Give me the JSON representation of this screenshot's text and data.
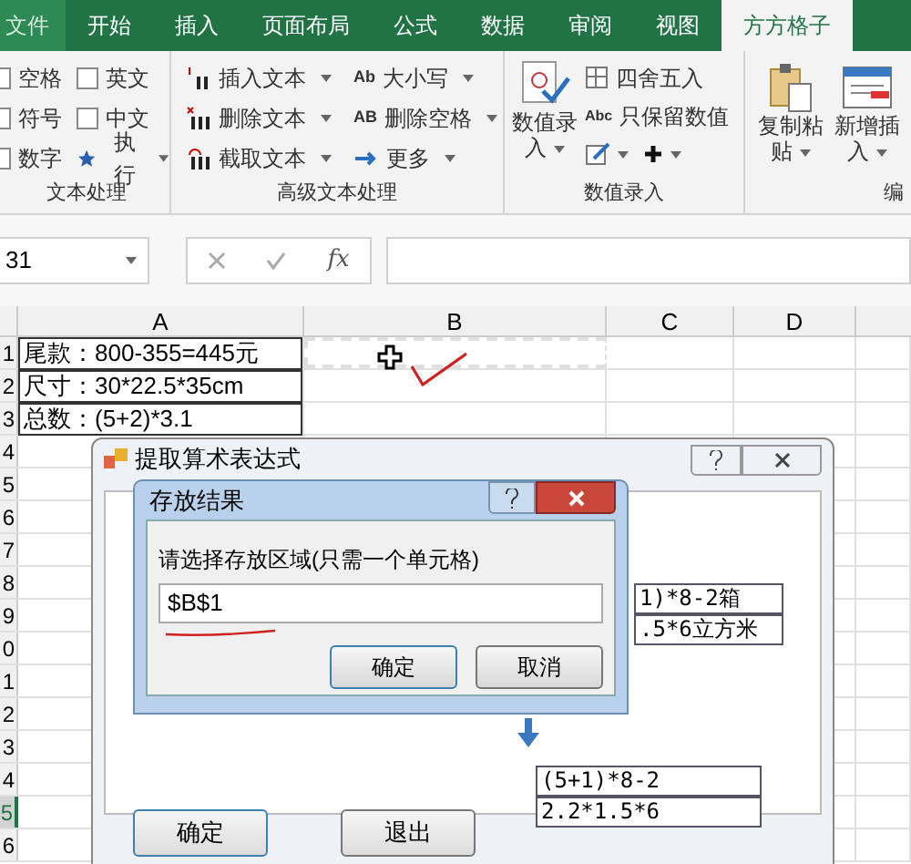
{
  "tabs": [
    {
      "label": "文件",
      "selected": false
    },
    {
      "label": "开始",
      "selected": false
    },
    {
      "label": "插入",
      "selected": false
    },
    {
      "label": "页面布局",
      "selected": false
    },
    {
      "label": "公式",
      "selected": false
    },
    {
      "label": "数据",
      "selected": false
    },
    {
      "label": "审阅",
      "selected": false
    },
    {
      "label": "视图",
      "selected": false
    },
    {
      "label": "方方格子",
      "selected": true
    }
  ],
  "ribbon": {
    "text_group": {
      "label": "文本处理",
      "checkboxes": [
        {
          "label": "空格",
          "checked": false
        },
        {
          "label": "符号",
          "checked": false
        },
        {
          "label": "数字",
          "checked": false
        },
        {
          "label": "英文",
          "checked": false
        },
        {
          "label": "中文",
          "checked": false
        }
      ],
      "run_button": "执行"
    },
    "advanced_group": {
      "label": "高级文本处理",
      "items": [
        {
          "label": "插入文本"
        },
        {
          "label": "删除文本"
        },
        {
          "label": "截取文本"
        },
        {
          "label": "大小写",
          "icon_text": "Ab"
        },
        {
          "label": "删除空格",
          "icon_text": "AB"
        },
        {
          "label": "更多"
        }
      ]
    },
    "number_group": {
      "label": "数值录入",
      "big_button": "数值录入",
      "items": [
        {
          "label": "四舍五入"
        },
        {
          "label": "只保留数值",
          "icon_text": "Abc"
        }
      ]
    },
    "edit_group": {
      "label": "编",
      "buttons": [
        "复制粘贴",
        "新增插入"
      ]
    }
  },
  "formula_bar": {
    "name_box": "31",
    "function_label": "fx"
  },
  "sheet": {
    "columns": [
      {
        "label": "A",
        "selected": false
      },
      {
        "label": "B",
        "selected": false
      },
      {
        "label": "C",
        "selected": false
      },
      {
        "label": "D",
        "selected": false
      }
    ],
    "rows": [
      {
        "number": "1",
        "selected": false,
        "cells": [
          "尾款：800-355=445元"
        ]
      },
      {
        "number": "2",
        "selected": false,
        "cells": [
          "尺寸：30*22.5*35cm"
        ]
      },
      {
        "number": "3",
        "selected": false,
        "cells": [
          "总数：(5+2)*3.1"
        ]
      },
      {
        "number": "4",
        "selected": false,
        "cells": []
      },
      {
        "number": "5",
        "selected": false,
        "cells": []
      },
      {
        "number": "6",
        "selected": false,
        "cells": []
      },
      {
        "number": "7",
        "selected": false,
        "cells": []
      },
      {
        "number": "8",
        "selected": false,
        "cells": []
      },
      {
        "number": "9",
        "selected": false,
        "cells": []
      },
      {
        "number": "0",
        "selected": false,
        "cells": []
      },
      {
        "number": "1",
        "selected": false,
        "cells": []
      },
      {
        "number": "2",
        "selected": false,
        "cells": []
      },
      {
        "number": "3",
        "selected": false,
        "cells": []
      },
      {
        "number": "4",
        "selected": false,
        "cells": []
      },
      {
        "number": "5",
        "selected": true,
        "cells": []
      },
      {
        "number": "6",
        "selected": false,
        "cells": []
      }
    ]
  },
  "extract_dialog": {
    "title": "提取算术表达式",
    "source_rows": [
      "1)*8-2箱",
      ".5*6立方米"
    ],
    "result_rows": [
      "(5+1)*8-2",
      "2.2*1.5*6"
    ],
    "buttons": [
      "确定",
      "退出"
    ]
  },
  "store_dialog": {
    "title": "存放结果",
    "prompt": "请选择存放区域(只需一个单元格)",
    "value": "$B$1",
    "buttons": [
      "确定",
      "取消"
    ]
  }
}
